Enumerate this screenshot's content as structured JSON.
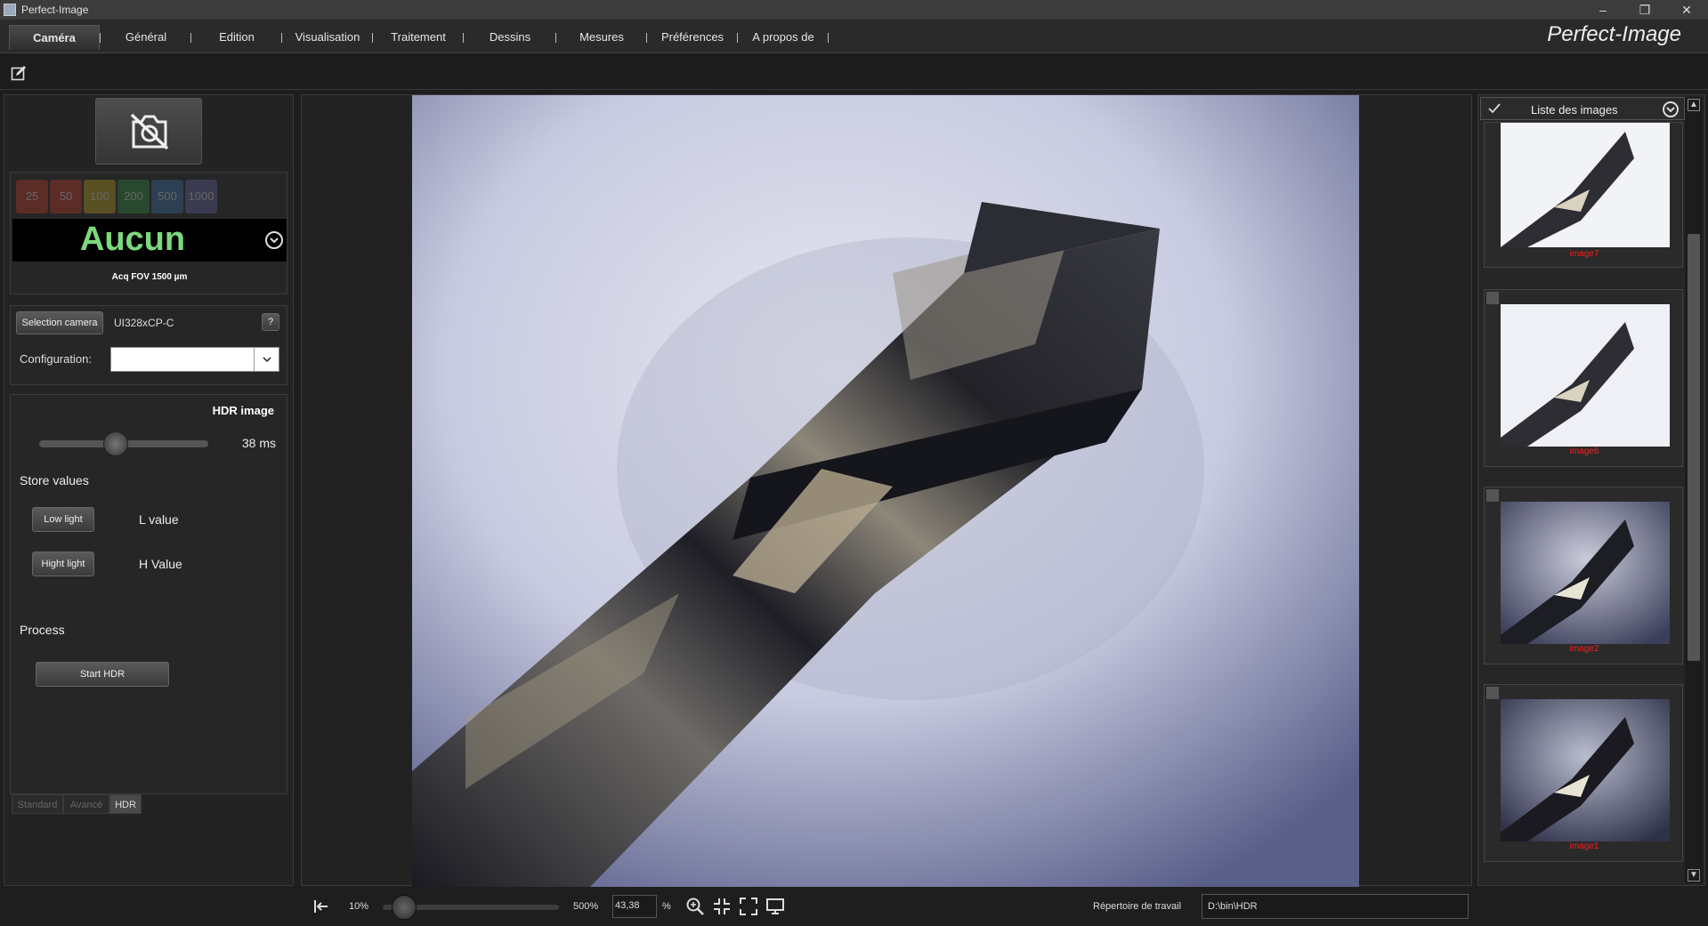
{
  "window": {
    "title": "Perfect-Image",
    "minimize": "–",
    "restore": "❐",
    "close": "✕"
  },
  "menu": {
    "items": [
      "Caméra",
      "Général",
      "Edition",
      "Visualisation",
      "Traitement",
      "Dessins",
      "Mesures",
      "Préférences",
      "A propos de"
    ],
    "active": "Caméra",
    "brand": "Perfect-Image"
  },
  "toolbar": {
    "edit_icon": "edit-icon"
  },
  "camera": {
    "snapshot_icon": "camera-off-icon",
    "magnifications": [
      "25",
      "50",
      "100",
      "200",
      "500",
      "1000"
    ],
    "magnification_colors": [
      "#c0392b",
      "#c0392b",
      "#b8a020",
      "#2e8b40",
      "#3a6ea5",
      "#6060a0"
    ],
    "objective": "Aucun",
    "fov": "Acq FOV 1500 µm",
    "select_camera_label": "Selection camera",
    "camera_model": "UI328xCP-C",
    "help_label": "?",
    "configuration_label": "Configuration:",
    "configuration_value": ""
  },
  "hdr": {
    "title": "HDR image",
    "exposure": "38 ms",
    "exposure_fraction": 0.45,
    "store_values_title": "Store values",
    "low_light_label": "Low light",
    "l_value": "L value",
    "high_light_label": "Hight light",
    "h_value": "H Value",
    "process_title": "Process",
    "start_label": "Start HDR"
  },
  "mode_tabs": {
    "items": [
      "Standard",
      "Avancé",
      "HDR"
    ],
    "active": "HDR"
  },
  "image_list": {
    "title": "Liste des images",
    "items": [
      {
        "label": "image7",
        "bg": "light"
      },
      {
        "label": "image6",
        "bg": "light"
      },
      {
        "label": "image2",
        "bg": "dark"
      },
      {
        "label": "image1",
        "bg": "dark"
      }
    ]
  },
  "status": {
    "zoom_min": "10%",
    "zoom_max": "500%",
    "zoom_value": "43,38",
    "zoom_unit": "%",
    "working_dir_label": "Répertoire de travail",
    "working_dir": "D:\\bin\\HDR"
  }
}
